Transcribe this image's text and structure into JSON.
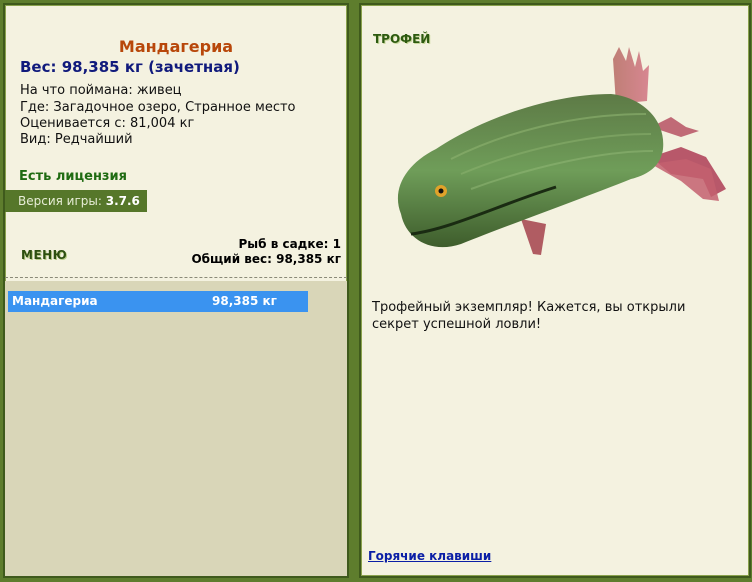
{
  "fish": {
    "name": "Мандагериа",
    "weight_line": "Вес: 98,385 кг (зачетная)",
    "caught_with": "На что поймана: живец",
    "location": "Где: Загадочное озеро, Странное место",
    "valued_at": "Оценивается с: 81,004 кг",
    "rarity": "Вид: Редчайший"
  },
  "license": "Есть лицензия",
  "version": {
    "label": "Версия игры:",
    "value": "3.7.6"
  },
  "menu_label": "МЕНЮ",
  "keepnet": {
    "fish_count": "Рыб в садке: 1",
    "total_weight": "Общий вес: 98,385 кг",
    "items": [
      {
        "name": "Мандагериа",
        "weight": "98,385 кг"
      }
    ]
  },
  "trophy": {
    "label": "ТРОФЕЙ",
    "message": "Трофейный экземпляр! Кажется, вы открыли секрет успешной ловли!"
  },
  "hotkeys_label": "Горячие клавиши",
  "colors": {
    "frame": "#5e7d2d",
    "panel": "#f4f2e0",
    "fish_name": "#b8470a",
    "weight": "#101a7c",
    "selection": "#3a93f0"
  }
}
